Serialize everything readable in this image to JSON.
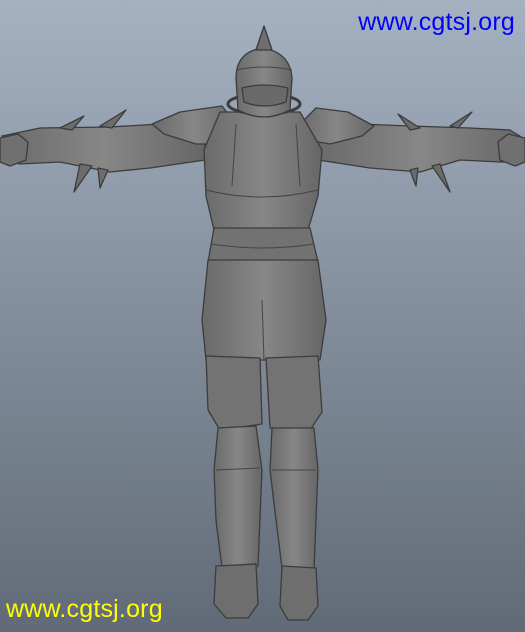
{
  "viewport": {
    "background_top": "#a4b1c1",
    "background_bottom": "#616b77",
    "model_color": "#7d7d7d",
    "model_shadow": "#5e5e5e",
    "edge_color": "#3c3c3c"
  },
  "watermarks": [
    {
      "text": "www.cgtsj.org",
      "color": "#0000ff"
    },
    {
      "text": "www.cgtsj.org",
      "color": "#ffff00"
    }
  ]
}
